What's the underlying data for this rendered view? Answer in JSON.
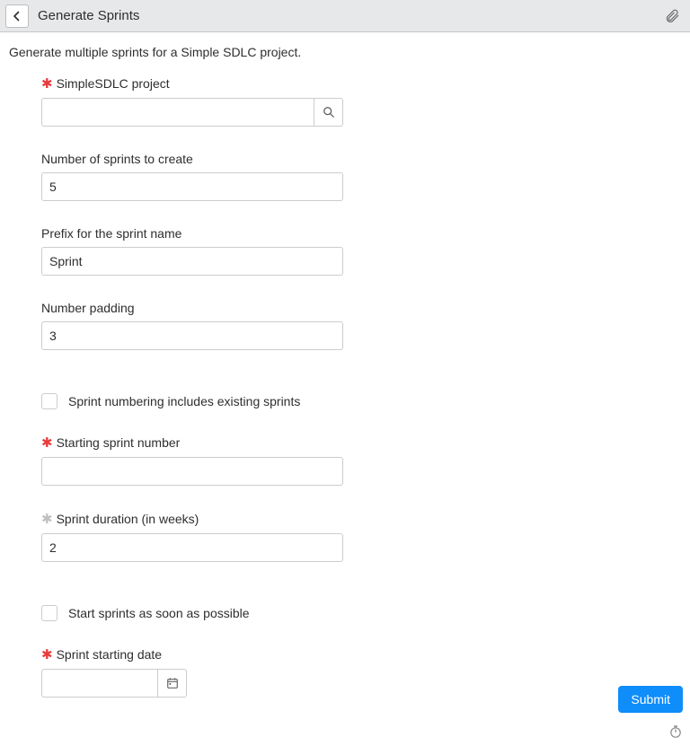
{
  "header": {
    "title": "Generate Sprints"
  },
  "description": "Generate multiple sprints for a Simple SDLC project.",
  "fields": {
    "project": {
      "label": "SimpleSDLC project",
      "value": ""
    },
    "numSprints": {
      "label": "Number of sprints to create",
      "value": "5"
    },
    "prefix": {
      "label": "Prefix for the sprint name",
      "value": "Sprint"
    },
    "padding": {
      "label": "Number padding",
      "value": "3"
    },
    "includeExisting": {
      "label": "Sprint numbering includes existing sprints",
      "checked": false
    },
    "startingNumber": {
      "label": "Starting sprint number",
      "value": ""
    },
    "duration": {
      "label": "Sprint duration (in weeks)",
      "value": "2"
    },
    "startAsap": {
      "label": "Start sprints as soon as possible",
      "checked": false
    },
    "startDate": {
      "label": "Sprint starting date",
      "value": ""
    }
  },
  "buttons": {
    "submit": "Submit"
  }
}
